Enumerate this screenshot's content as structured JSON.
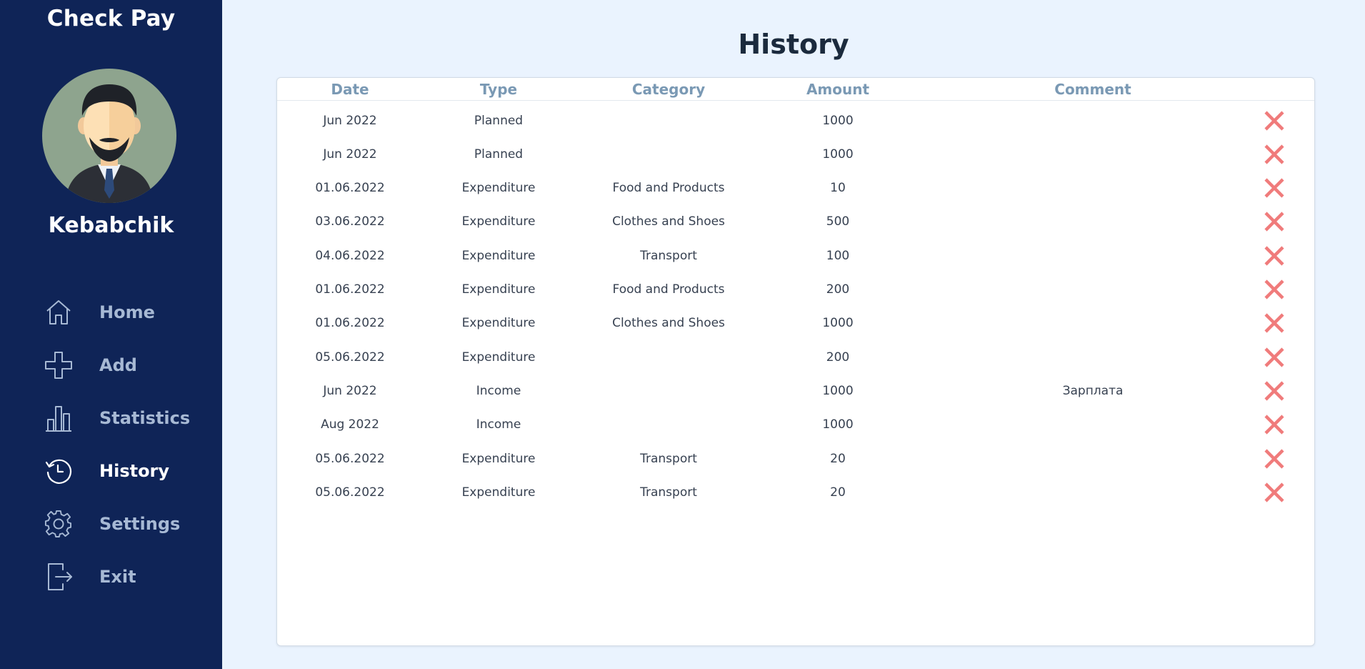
{
  "app": {
    "title": "Check Pay"
  },
  "user": {
    "name": "Kebabchik"
  },
  "nav": [
    {
      "label": "Home",
      "icon": "home-icon"
    },
    {
      "label": "Add",
      "icon": "plus-icon"
    },
    {
      "label": "Statistics",
      "icon": "bar-chart-icon"
    },
    {
      "label": "History",
      "icon": "history-icon",
      "active": true
    },
    {
      "label": "Settings",
      "icon": "gear-icon"
    },
    {
      "label": "Exit",
      "icon": "exit-icon"
    }
  ],
  "page": {
    "title": "History"
  },
  "table": {
    "columns": [
      "Date",
      "Type",
      "Category",
      "Amount",
      "Comment"
    ],
    "rows": [
      {
        "date": "Jun 2022",
        "type": "Planned",
        "category": "",
        "amount": "1000",
        "comment": ""
      },
      {
        "date": "Jun 2022",
        "type": "Planned",
        "category": "",
        "amount": "1000",
        "comment": ""
      },
      {
        "date": "01.06.2022",
        "type": "Expenditure",
        "category": "Food and Products",
        "amount": "10",
        "comment": ""
      },
      {
        "date": "03.06.2022",
        "type": "Expenditure",
        "category": "Clothes and Shoes",
        "amount": "500",
        "comment": ""
      },
      {
        "date": "04.06.2022",
        "type": "Expenditure",
        "category": "Transport",
        "amount": "100",
        "comment": ""
      },
      {
        "date": "01.06.2022",
        "type": "Expenditure",
        "category": "Food and Products",
        "amount": "200",
        "comment": ""
      },
      {
        "date": "01.06.2022",
        "type": "Expenditure",
        "category": "Clothes and Shoes",
        "amount": "1000",
        "comment": ""
      },
      {
        "date": "05.06.2022",
        "type": "Expenditure",
        "category": "",
        "amount": "200",
        "comment": ""
      },
      {
        "date": "Jun 2022",
        "type": "Income",
        "category": "",
        "amount": "1000",
        "comment": "Зарплата"
      },
      {
        "date": "Aug 2022",
        "type": "Income",
        "category": "",
        "amount": "1000",
        "comment": ""
      },
      {
        "date": "05.06.2022",
        "type": "Expenditure",
        "category": "Transport",
        "amount": "20",
        "comment": ""
      },
      {
        "date": "05.06.2022",
        "type": "Expenditure",
        "category": "Transport",
        "amount": "20",
        "comment": ""
      }
    ]
  },
  "colors": {
    "sidebar": "#0f2457",
    "background": "#eaf3fe",
    "header_text": "#7a99b4",
    "delete": "#f07b7b"
  }
}
